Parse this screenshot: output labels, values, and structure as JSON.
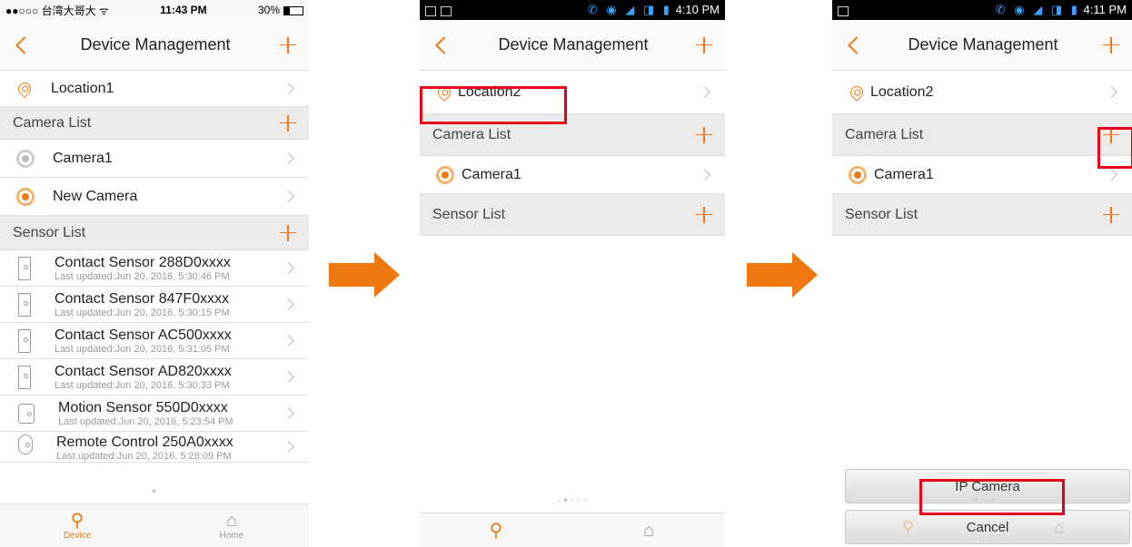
{
  "screen1": {
    "status": {
      "carrier": "●●○○○ 台湾大哥大 ᯤ",
      "time": "11:43 PM",
      "battery": "30%"
    },
    "title": "Device Management",
    "location": "Location1",
    "camera_section": "Camera List",
    "cameras": [
      "Camera1",
      "New Camera"
    ],
    "sensor_section": "Sensor List",
    "sensors": [
      {
        "name": "Contact Sensor 288D0xxxx",
        "updated": "Last updated:Jun 20, 2016, 5:30:46 PM"
      },
      {
        "name": "Contact Sensor 847F0xxxx",
        "updated": "Last updated:Jun 20, 2016, 5:30:15 PM"
      },
      {
        "name": "Contact Sensor AC500xxxx",
        "updated": "Last updated:Jun 20, 2016, 5:31:05 PM"
      },
      {
        "name": "Contact Sensor AD820xxxx",
        "updated": "Last updated:Jun 20, 2016, 5:30:33 PM"
      },
      {
        "name": "Motion Sensor 550D0xxxx",
        "updated": "Last updated:Jun 20, 2016, 5:23:54 PM"
      },
      {
        "name": "Remote Control 250A0xxxx",
        "updated": "Last updated:Jun 20, 2016, 5:28:09 PM"
      }
    ],
    "page_dot": "●",
    "tabs": {
      "device": "Device",
      "home": "Home"
    }
  },
  "screen2": {
    "status_time": "4:10 PM",
    "title": "Device Management",
    "location": "Location2",
    "camera_section": "Camera List",
    "camera": "Camera1",
    "sensor_section": "Sensor List",
    "page_dots": "○●○○○"
  },
  "screen3": {
    "status_time": "4:11 PM",
    "title": "Device Management",
    "location": "Location2",
    "camera_section": "Camera List",
    "camera": "Camera1",
    "sensor_section": "Sensor List",
    "sheet_option": "IP Camera",
    "sheet_cancel": "Cancel",
    "page_dots": "○●○○○"
  },
  "colors": {
    "accent": "#f07810",
    "highlight": "#e8001a",
    "arrow": "#ee7710"
  }
}
